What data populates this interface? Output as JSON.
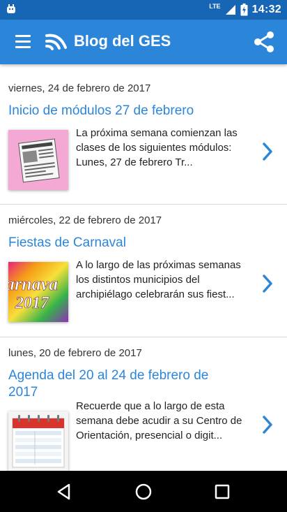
{
  "status": {
    "network": "LTE",
    "time": "14:32"
  },
  "header": {
    "title": "Blog del GES"
  },
  "posts": [
    {
      "date": "viernes, 24 de febrero de 2017",
      "title": "Inicio de módulos 27 de febrero",
      "excerpt": "La próxima semana comienzan las clases de los siguientes módulos: Lunes, 27 de febrero Tr..."
    },
    {
      "date": "miércoles, 22 de febrero de 2017",
      "title": "Fiestas de Carnaval",
      "excerpt": "A lo largo de las próximas semanas los distintos municipios del archipiélago celebrarán sus fiest...",
      "thumb_text_1": "arnava",
      "thumb_text_2": "2017"
    },
    {
      "date": "lunes, 20 de febrero de 2017",
      "title": "Agenda del 20 al 24 de febrero de 2017",
      "excerpt": "Recuerde que a lo largo de esta semana debe acudir a su Centro de Orientación, presencial o digit..."
    }
  ],
  "icons": {
    "menu": "hamburger-menu-icon",
    "logo": "wifi-feed-icon",
    "share": "share-icon",
    "chevron": "chevron-right-icon",
    "back": "back-triangle-icon",
    "home": "home-circle-icon",
    "recents": "recents-square-icon"
  },
  "colors": {
    "appbar": "#2b86d9",
    "statusbar": "#1766b5",
    "link": "#2b86d9",
    "navbar": "#000000"
  }
}
